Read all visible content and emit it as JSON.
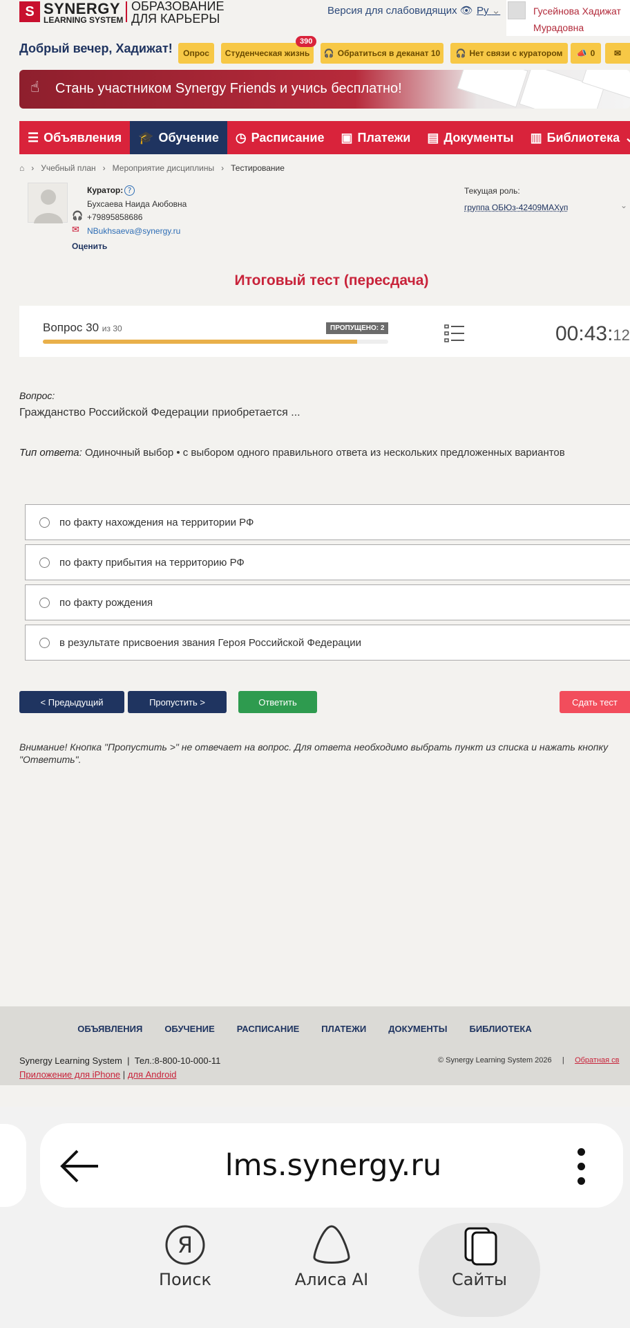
{
  "header": {
    "logo_mark": "S",
    "logo_line1": "SYNERGY",
    "logo_line2": "LEARNING SYSTEM",
    "logo_tagline": "ОБРАЗОВАНИЕ ДЛЯ КАРЬЕРЫ",
    "visually_impaired": "Версия для слабовидящих",
    "language": "Ру",
    "user_name": "Гусейнова Хадижат Мурадовна"
  },
  "greeting": "Добрый вечер, Хадижат!",
  "top_buttons": [
    {
      "label": "Опрос"
    },
    {
      "label": "Студенческая жизнь",
      "badge": "390"
    },
    {
      "label": "Обратиться в деканат 10"
    },
    {
      "label": "Нет связи с куратором"
    },
    {
      "label": "0"
    },
    {
      "label": ""
    }
  ],
  "banner": {
    "text": "Стань участником Synergy Friends и учись бесплатно!"
  },
  "nav": [
    {
      "label": "Объявления",
      "icon": "list-icon"
    },
    {
      "label": "Обучение",
      "icon": "graduation-cap-icon",
      "active": true
    },
    {
      "label": "Расписание",
      "icon": "clock-icon"
    },
    {
      "label": "Платежи",
      "icon": "money-icon"
    },
    {
      "label": "Документы",
      "icon": "document-icon"
    },
    {
      "label": "Библиотека",
      "icon": "book-icon"
    }
  ],
  "breadcrumbs": [
    "Учебный план",
    "Мероприятие дисциплины",
    "Тестирование"
  ],
  "curator": {
    "label": "Куратор:",
    "name": "Бухсаева Наида Аюбовна",
    "phone": "+79895858686",
    "email": "NBukhsaeva@synergy.ru",
    "rate": "Оценить"
  },
  "role": {
    "label": "Текущая роль:",
    "value": "группа ОБЮз-42409МАХуп"
  },
  "test": {
    "title": "Итоговый тест (пересдача)",
    "question_label": "Вопрос 30",
    "question_of": "из 30",
    "skipped": "ПРОПУЩЕНО: 2",
    "progress": 0.91,
    "timer_main": "00:43:",
    "timer_sec": "12"
  },
  "question": {
    "label": "Вопрос:",
    "text": "Гражданство Российской Федерации приобретается ...",
    "type_label": "Тип ответа:",
    "type_text": "Одиночный выбор • с выбором одного правильного ответа из нескольких предложенных вариантов"
  },
  "options": [
    "по факту нахождения на территории РФ",
    "по факту прибытия на территорию РФ",
    "по факту рождения",
    "в результате присвоения звания Героя Российской Федерации"
  ],
  "actions": {
    "prev": "< Предыдущий",
    "skip": "Пропустить >",
    "answer": "Ответить",
    "submit": "Сдать тест"
  },
  "warning": "Внимание! Кнопка \"Пропустить >\" не отвечает на вопрос. Для ответа необходимо выбрать пункт из списка и нажать кнопку \"Ответить\".",
  "footer": {
    "links": [
      "ОБЪЯВЛЕНИЯ",
      "ОБУЧЕНИЕ",
      "РАСПИСАНИЕ",
      "ПЛАТЕЖИ",
      "ДОКУМЕНТЫ",
      "БИБЛИОТЕКА"
    ],
    "company": "Synergy Learning System",
    "phone": "Тел.:8-800-10-000-11",
    "iphone": "Приложение для iPhone",
    "android": "для Android",
    "copyright": "© Synergy Learning System 2026",
    "feedback": "Обратная св"
  },
  "browser": {
    "url": "lms.synergy.ru",
    "bottom_nav": [
      "Поиск",
      "Алиса AI",
      "Сайты"
    ]
  },
  "colors": {
    "brand_red": "#d9233b",
    "brand_navy": "#1f3460",
    "yellow": "#f7c846",
    "green": "#2e9b4f",
    "progress": "#e9b04a"
  }
}
